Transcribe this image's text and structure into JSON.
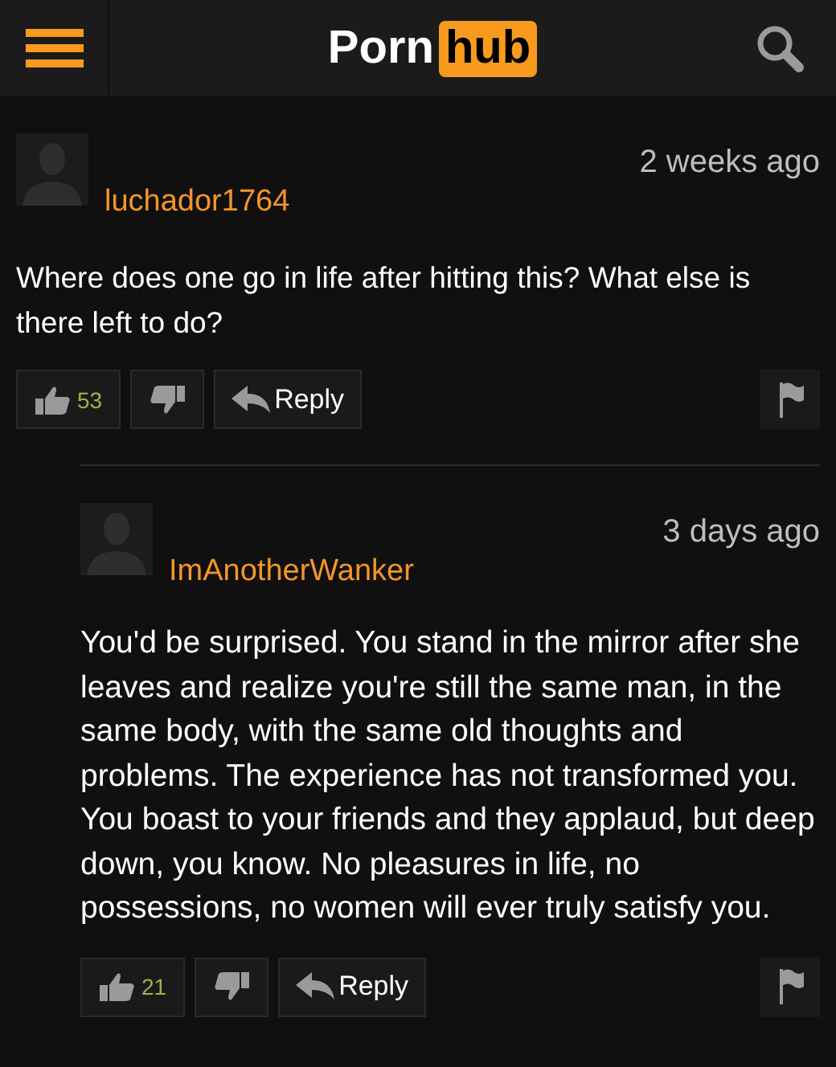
{
  "header": {
    "logo_left": "Porn",
    "logo_right": "hub"
  },
  "comments": [
    {
      "username": "luchador1764",
      "time": "2 weeks ago",
      "text": "Where does one go in life after hitting this? What else is there left to do?",
      "likes": "53",
      "reply_label": "Reply",
      "children": [
        {
          "username": "ImAnotherWanker",
          "time": "3 days ago",
          "text": "You'd be surprised. You stand in the mirror after she leaves and realize you're still the same man, in the same body, with the same old thoughts and problems. The experience has not transformed you. You boast to your friends and they applaud, but deep down, you know. No pleasures in life, no possessions, no women will ever truly satisfy you.",
          "likes": "21",
          "reply_label": "Reply"
        }
      ]
    }
  ]
}
